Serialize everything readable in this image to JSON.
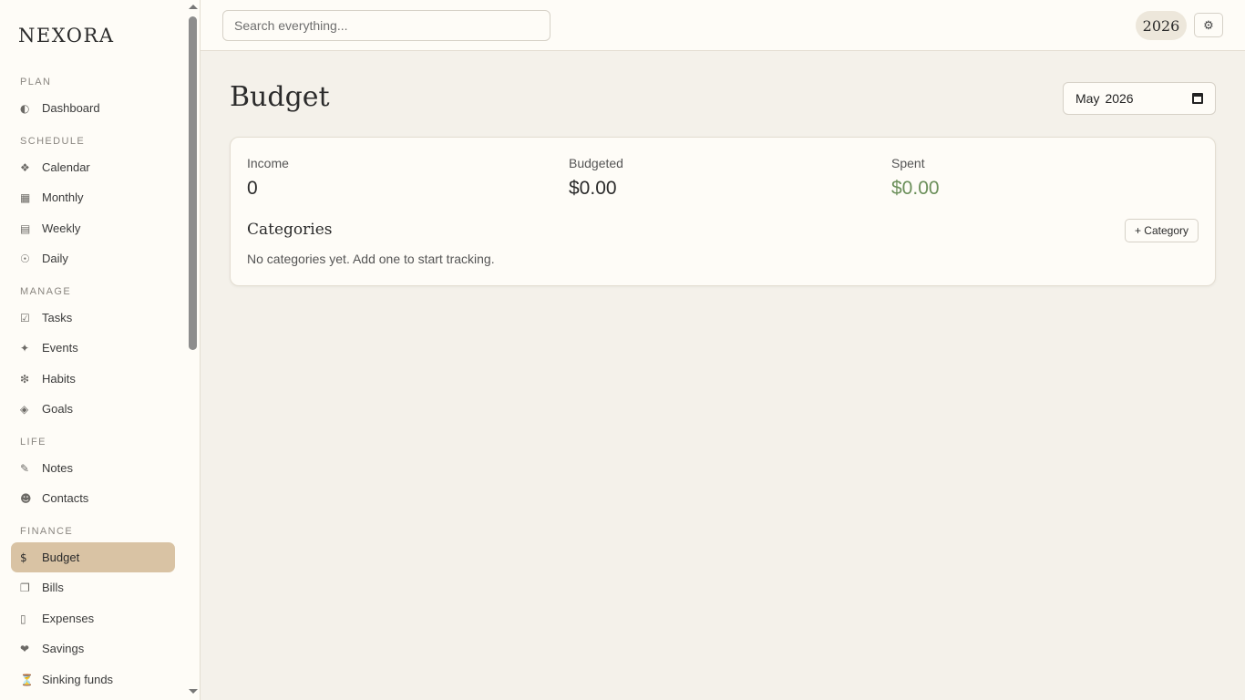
{
  "app": {
    "name": "NEXORA"
  },
  "sidebar": {
    "sections": [
      {
        "label": "PLAN",
        "items": [
          {
            "label": "Dashboard",
            "icon": "◐"
          }
        ]
      },
      {
        "label": "SCHEDULE",
        "items": [
          {
            "label": "Calendar",
            "icon": "❖"
          },
          {
            "label": "Monthly",
            "icon": "▦"
          },
          {
            "label": "Weekly",
            "icon": "▤"
          },
          {
            "label": "Daily",
            "icon": "☉"
          }
        ]
      },
      {
        "label": "MANAGE",
        "items": [
          {
            "label": "Tasks",
            "icon": "☑"
          },
          {
            "label": "Events",
            "icon": "✦"
          },
          {
            "label": "Habits",
            "icon": "❇"
          },
          {
            "label": "Goals",
            "icon": "◈"
          }
        ]
      },
      {
        "label": "LIFE",
        "items": [
          {
            "label": "Notes",
            "icon": "✎"
          },
          {
            "label": "Contacts",
            "icon": "☻"
          }
        ]
      },
      {
        "label": "FINANCE",
        "items": [
          {
            "label": "Budget",
            "icon": "$",
            "active": true
          },
          {
            "label": "Bills",
            "icon": "❐"
          },
          {
            "label": "Expenses",
            "icon": "▯"
          },
          {
            "label": "Savings",
            "icon": "❤"
          },
          {
            "label": "Sinking funds",
            "icon": "⏳"
          }
        ]
      }
    ]
  },
  "topbar": {
    "search_placeholder": "Search everything...",
    "year": "2026",
    "settings_icon": "⚙"
  },
  "main": {
    "title": "Budget",
    "month_picker": {
      "month": "May",
      "year": "2026"
    },
    "summary": {
      "income_label": "Income",
      "income_value": "0",
      "budgeted_label": "Budgeted",
      "budgeted_value": "$0.00",
      "spent_label": "Spent",
      "spent_value": "$0.00",
      "spent_color": "#6b8f5a"
    },
    "categories": {
      "title": "Categories",
      "add_label": "+ Category",
      "empty_text": "No categories yet. Add one to start tracking."
    }
  }
}
